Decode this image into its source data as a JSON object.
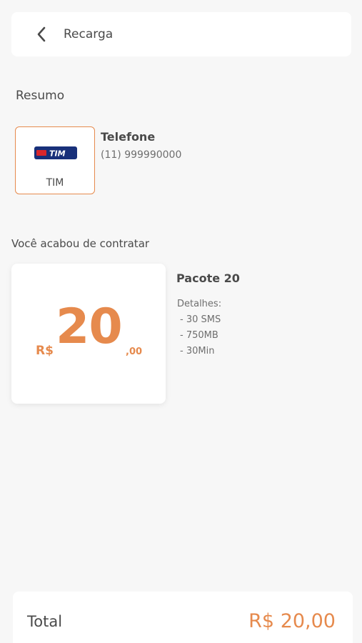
{
  "header": {
    "title": "Recarga",
    "back_icon": "chevron-left-icon"
  },
  "summary": {
    "title": "Resumo",
    "operator": {
      "name": "TIM",
      "logo_text": "TIM",
      "logo_colors": {
        "background": "#18307a",
        "accent": "#d9262c",
        "text": "#ffffff"
      }
    },
    "phone": {
      "label": "Telefone",
      "number": "(11) 999990000"
    }
  },
  "contracted": {
    "title": "Você acabou de contratar",
    "price": {
      "currency": "R$",
      "integer": "20",
      "cents": ",00"
    },
    "package": {
      "name": "Pacote 20",
      "details_label": "Detalhes:",
      "details": [
        "- 30 SMS",
        "- 750MB",
        "- 30Min"
      ]
    }
  },
  "total": {
    "label": "Total",
    "value": "R$ 20,00"
  },
  "colors": {
    "accent": "#e68a4d",
    "background": "#f7f7f7",
    "card": "#ffffff",
    "text": "#4a4a4a"
  }
}
